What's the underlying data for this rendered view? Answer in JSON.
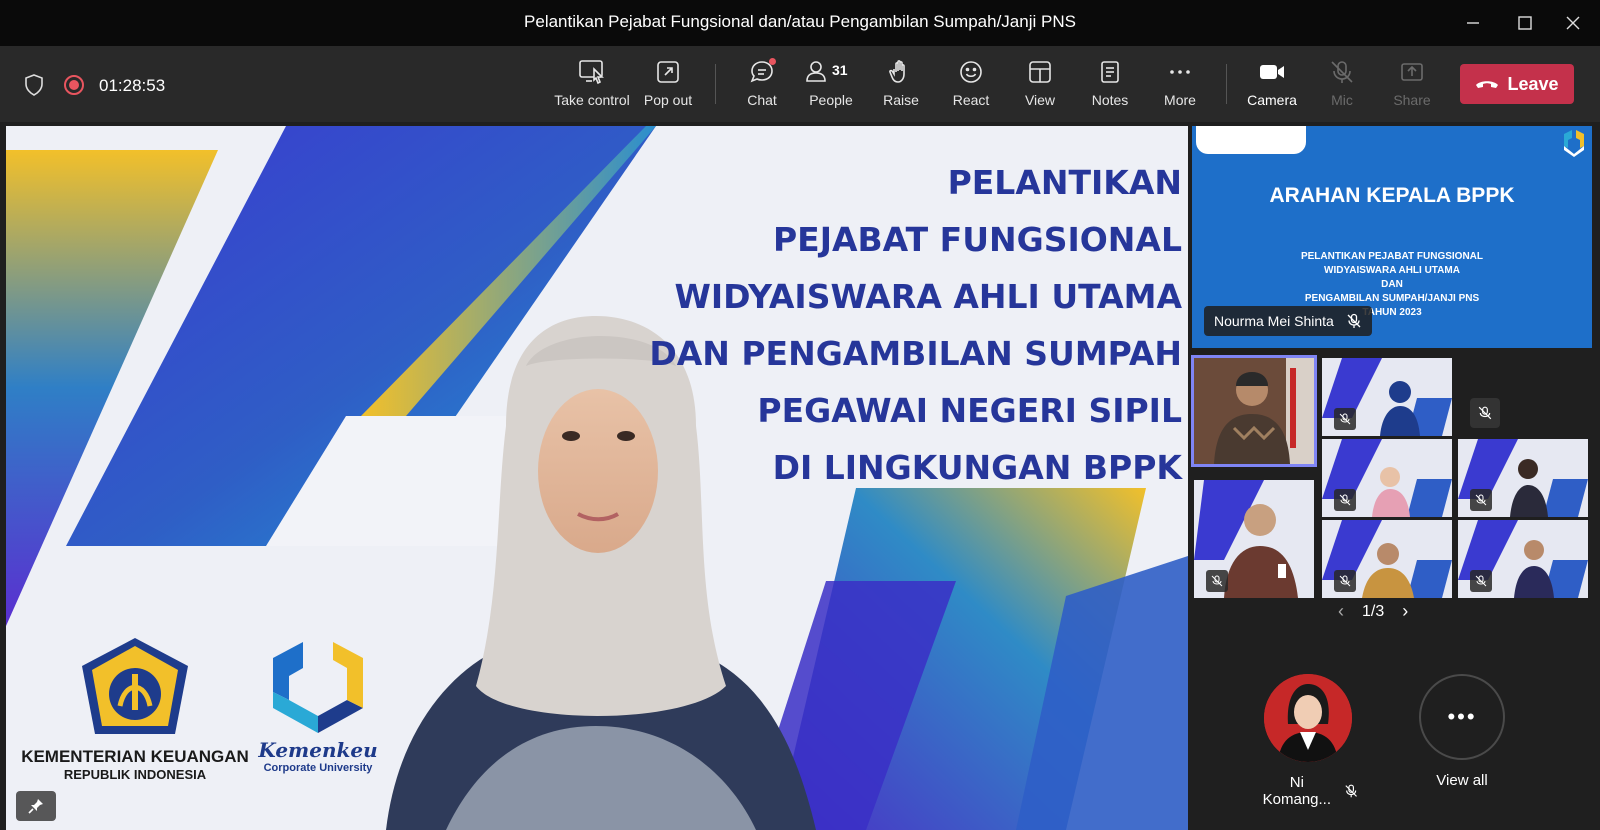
{
  "window": {
    "title": "Pelantikan Pejabat Fungsional dan/atau Pengambilan Sumpah/Janji PNS"
  },
  "toolbar": {
    "timer": "01:28:53",
    "take_control": "Take control",
    "pop_out": "Pop out",
    "chat": "Chat",
    "people": "People",
    "people_count": "31",
    "raise": "Raise",
    "react": "React",
    "view": "View",
    "notes": "Notes",
    "more": "More",
    "camera": "Camera",
    "mic": "Mic",
    "share": "Share",
    "leave": "Leave",
    "leave_color": "#c4314b"
  },
  "stage": {
    "slide_lines": [
      "PELANTIKAN",
      "PEJABAT FUNGSIONAL",
      "WIDYAISWARA AHLI UTAMA",
      "DAN PENGAMBILAN SUMPAH",
      "PEGAWAI NEGERI SIPIL",
      "DI LINGKUNGAN BPPK"
    ],
    "logo1_line1": "KEMENTERIAN KEUANGAN",
    "logo1_line2": "REPUBLIK INDONESIA",
    "logo2_line1": "Kemenkeu",
    "logo2_line2": "Corporate University"
  },
  "shared_screen": {
    "heading": "ARAHAN KEPALA BPPK",
    "line1": "PELANTIKAN PEJABAT FUNGSIONAL",
    "line2": "WIDYAISWARA AHLI UTAMA",
    "line3": "DAN",
    "line4": "PENGAMBILAN SUMPAH/JANJI PNS",
    "line5": "TAHUN 2023",
    "presenter": "Nourma Mei Shinta"
  },
  "gallery": {
    "page_indicator": "1/3"
  },
  "presence": {
    "participant_name": "Ni Komang...",
    "view_all": "View all"
  }
}
